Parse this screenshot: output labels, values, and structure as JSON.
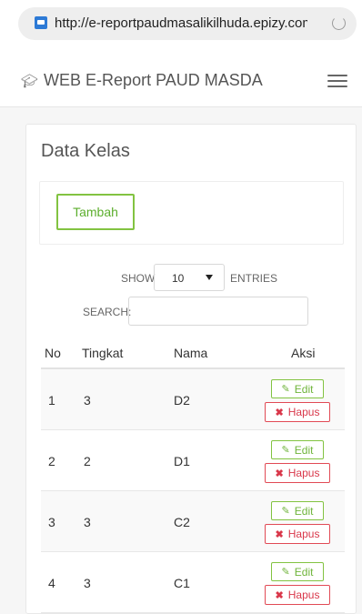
{
  "browser": {
    "url": "http://e-reportpaudmasalikilhuda.epizy.com/",
    "icons": {
      "site": "site-favicon-icon",
      "reload": "reload-icon"
    }
  },
  "navbar": {
    "brand": "WEB E-Report PAUD MASDA",
    "brand_icon": "graduation-cap-icon",
    "menu_icon": "hamburger-menu-icon"
  },
  "page": {
    "title": "Data Kelas",
    "add_button": "Tambah",
    "show_label": "SHOW",
    "show_value": "10",
    "entries_label": "ENTRIES",
    "search_label": "SEARCH:",
    "search_value": ""
  },
  "table": {
    "headers": {
      "no": "No",
      "tingkat": "Tingkat",
      "nama": "Nama",
      "aksi": "Aksi"
    },
    "rows": [
      {
        "no": "1",
        "tingkat": "3",
        "nama": "D2"
      },
      {
        "no": "2",
        "tingkat": "2",
        "nama": "D1"
      },
      {
        "no": "3",
        "tingkat": "3",
        "nama": "C2"
      },
      {
        "no": "4",
        "tingkat": "3",
        "nama": "C1"
      }
    ],
    "actions": {
      "edit_label": "Edit",
      "edit_icon": "edit-icon",
      "delete_label": "Hapus",
      "delete_icon": "close-icon"
    }
  },
  "colors": {
    "edit": "#82c341",
    "delete": "#e14a55"
  }
}
